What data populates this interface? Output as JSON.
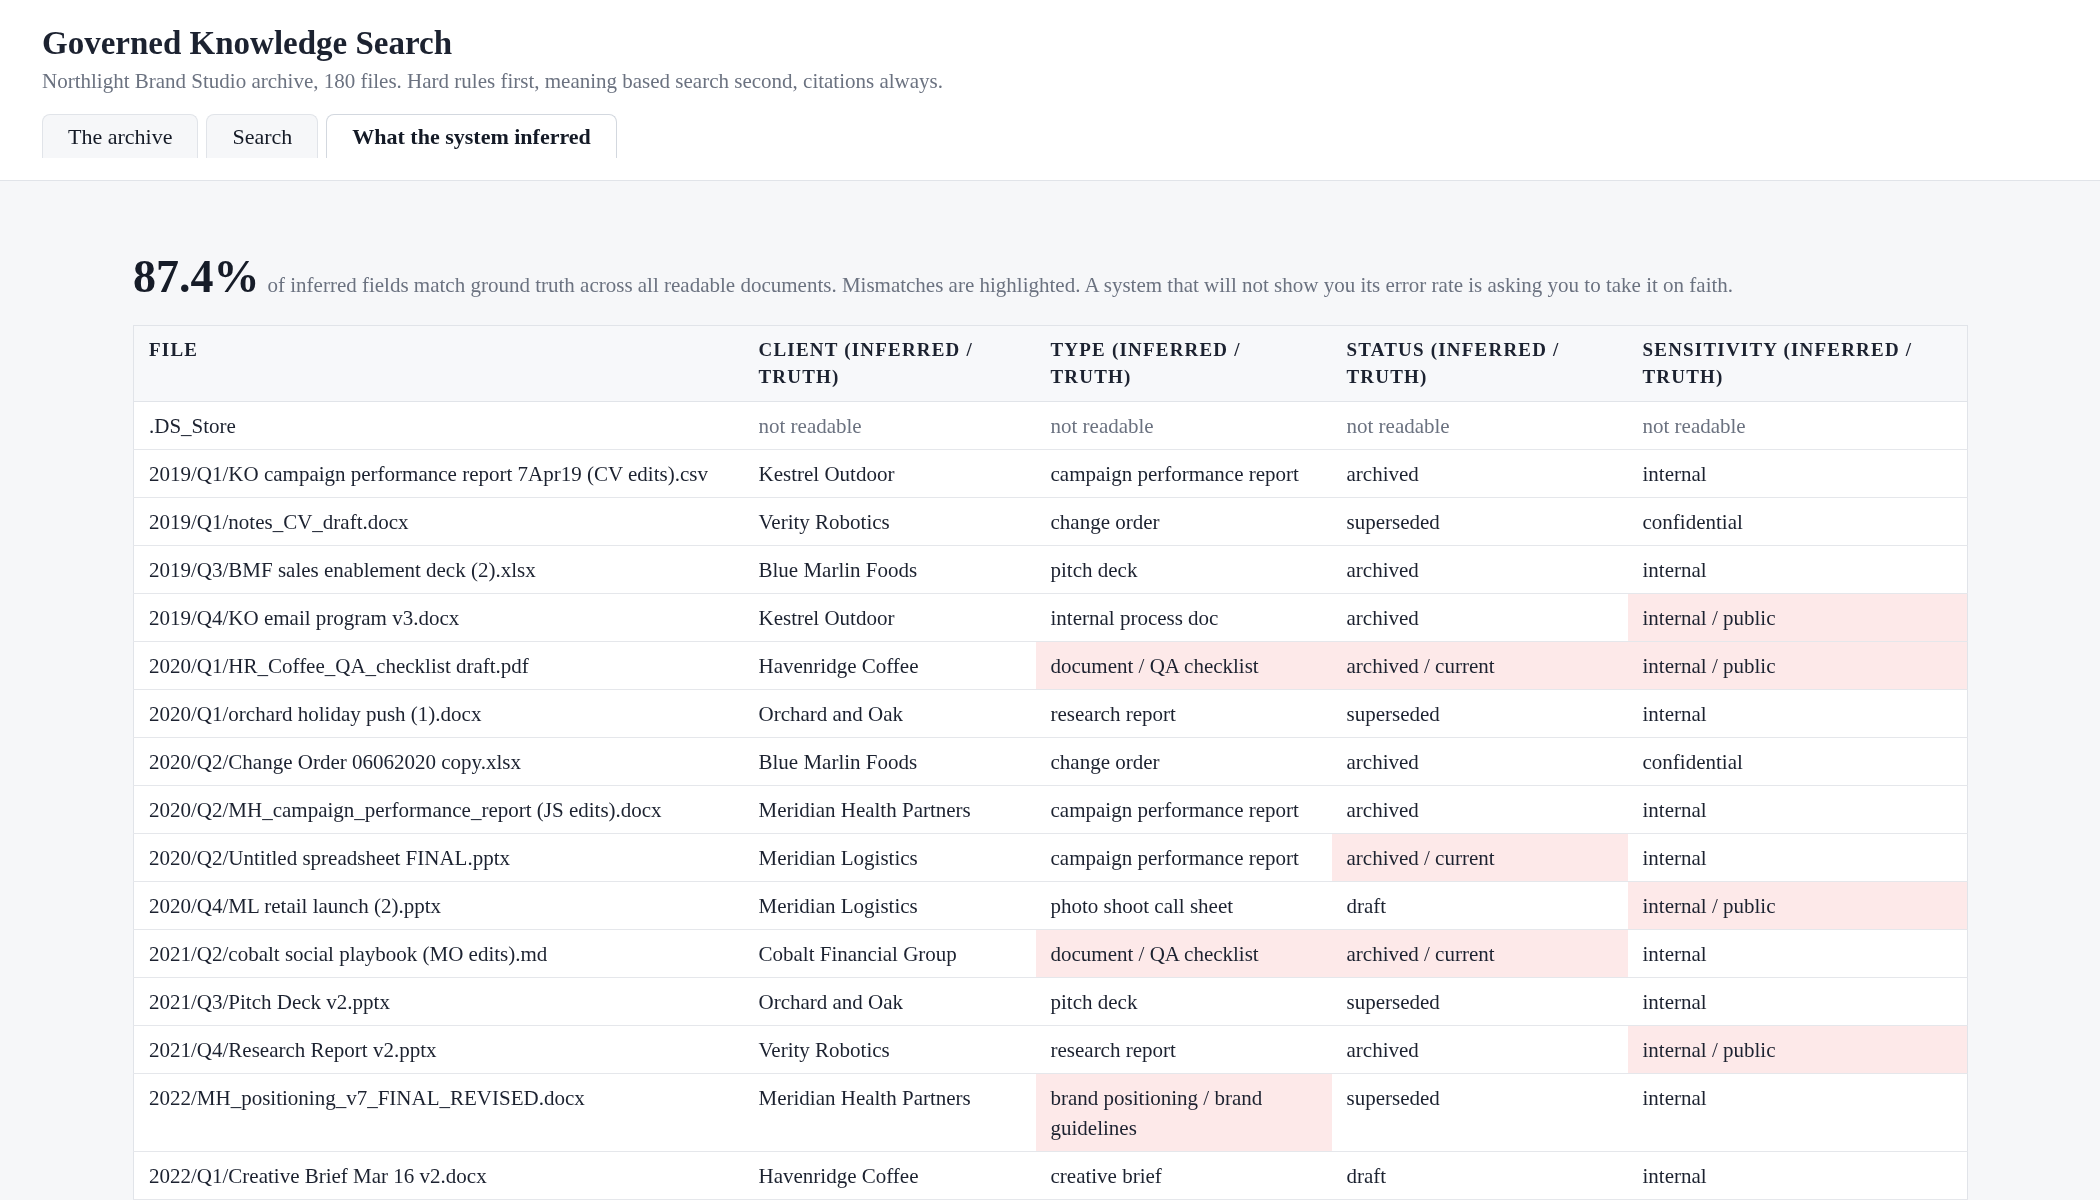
{
  "header": {
    "title": "Governed Knowledge Search",
    "subtitle": "Northlight Brand Studio archive, 180 files. Hard rules first, meaning based search second, citations always."
  },
  "tabs": [
    {
      "label": "The archive",
      "selected": false
    },
    {
      "label": "Search",
      "selected": false
    },
    {
      "label": "What the system inferred",
      "selected": true
    }
  ],
  "summary": {
    "value": "87.4%",
    "description": "of inferred fields match ground truth across all readable documents. Mismatches are highlighted. A system that will not show you its error rate is asking you to take it on faith."
  },
  "table": {
    "columns": [
      "FILE",
      "CLIENT (INFERRED / TRUTH)",
      "TYPE (INFERRED / TRUTH)",
      "STATUS (INFERRED / TRUTH)",
      "SENSITIVITY (INFERRED / TRUTH)"
    ],
    "rows": [
      {
        "readable": false,
        "cells": [
          {
            "text": ".DS_Store",
            "mismatch": false
          },
          {
            "text": "not readable",
            "mismatch": false
          },
          {
            "text": "not readable",
            "mismatch": false
          },
          {
            "text": "not readable",
            "mismatch": false
          },
          {
            "text": "not readable",
            "mismatch": false
          }
        ]
      },
      {
        "readable": true,
        "cells": [
          {
            "text": "2019/Q1/KO campaign performance report 7Apr19 (CV edits).csv",
            "mismatch": false
          },
          {
            "text": "Kestrel Outdoor",
            "mismatch": false
          },
          {
            "text": "campaign performance report",
            "mismatch": false
          },
          {
            "text": "archived",
            "mismatch": false
          },
          {
            "text": "internal",
            "mismatch": false
          }
        ]
      },
      {
        "readable": true,
        "cells": [
          {
            "text": "2019/Q1/notes_CV_draft.docx",
            "mismatch": false
          },
          {
            "text": "Verity Robotics",
            "mismatch": false
          },
          {
            "text": "change order",
            "mismatch": false
          },
          {
            "text": "superseded",
            "mismatch": false
          },
          {
            "text": "confidential",
            "mismatch": false
          }
        ]
      },
      {
        "readable": true,
        "cells": [
          {
            "text": "2019/Q3/BMF sales enablement deck (2).xlsx",
            "mismatch": false
          },
          {
            "text": "Blue Marlin Foods",
            "mismatch": false
          },
          {
            "text": "pitch deck",
            "mismatch": false
          },
          {
            "text": "archived",
            "mismatch": false
          },
          {
            "text": "internal",
            "mismatch": false
          }
        ]
      },
      {
        "readable": true,
        "cells": [
          {
            "text": "2019/Q4/KO email program v3.docx",
            "mismatch": false
          },
          {
            "text": "Kestrel Outdoor",
            "mismatch": false
          },
          {
            "text": "internal process doc",
            "mismatch": false
          },
          {
            "text": "archived",
            "mismatch": false
          },
          {
            "text": "internal / public",
            "mismatch": true
          }
        ]
      },
      {
        "readable": true,
        "cells": [
          {
            "text": "2020/Q1/HR_Coffee_QA_checklist draft.pdf",
            "mismatch": false
          },
          {
            "text": "Havenridge Coffee",
            "mismatch": false
          },
          {
            "text": "document / QA checklist",
            "mismatch": true
          },
          {
            "text": "archived / current",
            "mismatch": true
          },
          {
            "text": "internal / public",
            "mismatch": true
          }
        ]
      },
      {
        "readable": true,
        "cells": [
          {
            "text": "2020/Q1/orchard holiday push (1).docx",
            "mismatch": false
          },
          {
            "text": "Orchard and Oak",
            "mismatch": false
          },
          {
            "text": "research report",
            "mismatch": false
          },
          {
            "text": "superseded",
            "mismatch": false
          },
          {
            "text": "internal",
            "mismatch": false
          }
        ]
      },
      {
        "readable": true,
        "cells": [
          {
            "text": "2020/Q2/Change Order 06062020 copy.xlsx",
            "mismatch": false
          },
          {
            "text": "Blue Marlin Foods",
            "mismatch": false
          },
          {
            "text": "change order",
            "mismatch": false
          },
          {
            "text": "archived",
            "mismatch": false
          },
          {
            "text": "confidential",
            "mismatch": false
          }
        ]
      },
      {
        "readable": true,
        "cells": [
          {
            "text": "2020/Q2/MH_campaign_performance_report (JS edits).docx",
            "mismatch": false
          },
          {
            "text": "Meridian Health Partners",
            "mismatch": false
          },
          {
            "text": "campaign performance report",
            "mismatch": false
          },
          {
            "text": "archived",
            "mismatch": false
          },
          {
            "text": "internal",
            "mismatch": false
          }
        ]
      },
      {
        "readable": true,
        "cells": [
          {
            "text": "2020/Q2/Untitled spreadsheet FINAL.pptx",
            "mismatch": false
          },
          {
            "text": "Meridian Logistics",
            "mismatch": false
          },
          {
            "text": "campaign performance report",
            "mismatch": false
          },
          {
            "text": "archived / current",
            "mismatch": true
          },
          {
            "text": "internal",
            "mismatch": false
          }
        ]
      },
      {
        "readable": true,
        "cells": [
          {
            "text": "2020/Q4/ML retail launch (2).pptx",
            "mismatch": false
          },
          {
            "text": "Meridian Logistics",
            "mismatch": false
          },
          {
            "text": "photo shoot call sheet",
            "mismatch": false
          },
          {
            "text": "draft",
            "mismatch": false
          },
          {
            "text": "internal / public",
            "mismatch": true
          }
        ]
      },
      {
        "readable": true,
        "cells": [
          {
            "text": "2021/Q2/cobalt social playbook (MO edits).md",
            "mismatch": false
          },
          {
            "text": "Cobalt Financial Group",
            "mismatch": false
          },
          {
            "text": "document / QA checklist",
            "mismatch": true
          },
          {
            "text": "archived / current",
            "mismatch": true
          },
          {
            "text": "internal",
            "mismatch": false
          }
        ]
      },
      {
        "readable": true,
        "cells": [
          {
            "text": "2021/Q3/Pitch Deck v2.pptx",
            "mismatch": false
          },
          {
            "text": "Orchard and Oak",
            "mismatch": false
          },
          {
            "text": "pitch deck",
            "mismatch": false
          },
          {
            "text": "superseded",
            "mismatch": false
          },
          {
            "text": "internal",
            "mismatch": false
          }
        ]
      },
      {
        "readable": true,
        "cells": [
          {
            "text": "2021/Q4/Research Report v2.pptx",
            "mismatch": false
          },
          {
            "text": "Verity Robotics",
            "mismatch": false
          },
          {
            "text": "research report",
            "mismatch": false
          },
          {
            "text": "archived",
            "mismatch": false
          },
          {
            "text": "internal / public",
            "mismatch": true
          }
        ]
      },
      {
        "readable": true,
        "cells": [
          {
            "text": "2022/MH_positioning_v7_FINAL_REVISED.docx",
            "mismatch": false
          },
          {
            "text": "Meridian Health Partners",
            "mismatch": false
          },
          {
            "text": "brand positioning / brand guidelines",
            "mismatch": true
          },
          {
            "text": "superseded",
            "mismatch": false
          },
          {
            "text": "internal",
            "mismatch": false
          }
        ]
      },
      {
        "readable": true,
        "cells": [
          {
            "text": "2022/Q1/Creative Brief Mar 16 v2.docx",
            "mismatch": false
          },
          {
            "text": "Havenridge Coffee",
            "mismatch": false
          },
          {
            "text": "creative brief",
            "mismatch": false
          },
          {
            "text": "draft",
            "mismatch": false
          },
          {
            "text": "internal",
            "mismatch": false
          }
        ]
      }
    ]
  }
}
